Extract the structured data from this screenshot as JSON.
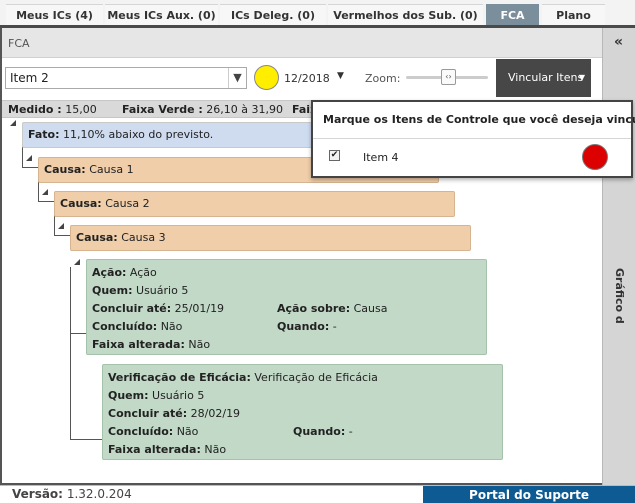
{
  "tabs": [
    {
      "label": "Meus ICs (4)"
    },
    {
      "label": "Meus ICs Aux. (0)"
    },
    {
      "label": "ICs Deleg. (0)"
    },
    {
      "label": "Vermelhos dos Sub. (0)"
    },
    {
      "label": "FCA"
    },
    {
      "label": "Plano"
    }
  ],
  "panel_title": "FCA",
  "right_panel": {
    "label": "Gráfico d",
    "collapse_icon": "double-chevron-left-icon"
  },
  "toolbar": {
    "item_select_value": "Item 2",
    "status_color": "#ffee00",
    "period": "12/2018",
    "zoom_label": "Zoom:",
    "link_button_label": "Vincular Itens"
  },
  "measure": {
    "medido_label": "Medido :",
    "medido_value": "15,00",
    "faixa_verde_label": "Faixa Verde :",
    "faixa_verde_value": "26,10 à 31,90",
    "faixa_cut_label": "Faix"
  },
  "tree": {
    "fato": {
      "label": "Fato:",
      "value": "11,10% abaixo do previsto."
    },
    "causas": [
      {
        "label": "Causa:",
        "value": "Causa 1"
      },
      {
        "label": "Causa:",
        "value": "Causa 2"
      },
      {
        "label": "Causa:",
        "value": "Causa 3"
      }
    ],
    "acao": {
      "acao_label": "Ação:",
      "acao_value": "Ação",
      "quem_label": "Quem:",
      "quem_value": "Usuário 5",
      "concluir_label": "Concluir até:",
      "concluir_value": "25/01/19",
      "acao_sobre_label": "Ação sobre:",
      "acao_sobre_value": "Causa",
      "concluido_label": "Concluído:",
      "concluido_value": "Não",
      "quando_label": "Quando:",
      "quando_value": "-",
      "faixa_label": "Faixa alterada:",
      "faixa_value": "Não"
    },
    "verificacao": {
      "ver_label": "Verificação de Eficácia:",
      "ver_value": "Verificação de Eficácia",
      "quem_label": "Quem:",
      "quem_value": "Usuário 5",
      "concluir_label": "Concluir até:",
      "concluir_value": "28/02/19",
      "concluido_label": "Concluído:",
      "concluido_value": "Não",
      "quando_label": "Quando:",
      "quando_value": "-",
      "faixa_label": "Faixa alterada:",
      "faixa_value": "Não"
    }
  },
  "popup": {
    "title": "Marque os Itens de Controle que você deseja vincular",
    "item_label": "Item 4",
    "item_checked": true,
    "item_status_color": "#dd0000"
  },
  "footer": {
    "version_label": "Versão:",
    "version_value": "1.32.0.204",
    "portal_label": "Portal do Suporte"
  }
}
